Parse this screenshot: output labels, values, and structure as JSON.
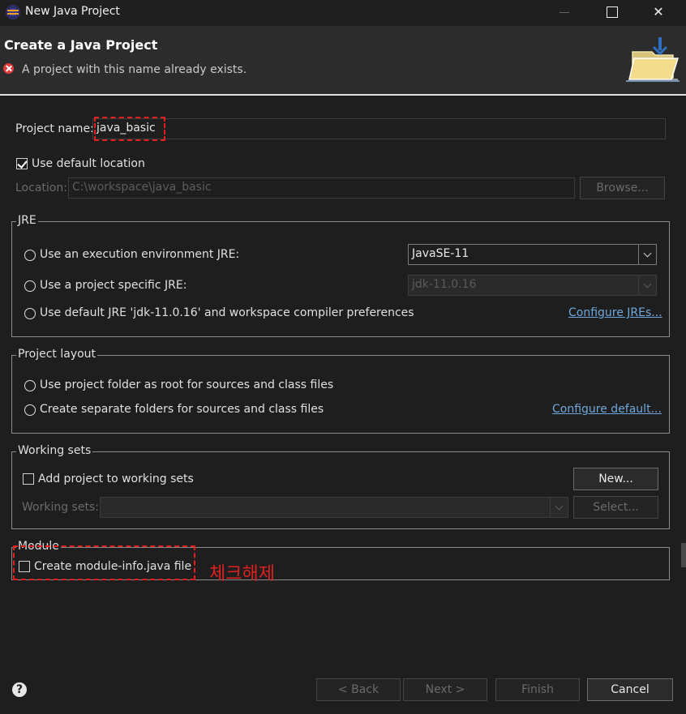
{
  "window": {
    "title": "New Java Project"
  },
  "header": {
    "title": "Create a Java Project",
    "message": "A project with this name already exists."
  },
  "project_name": {
    "label": "Project name:",
    "value": "java_basic"
  },
  "location": {
    "use_default_label": "Use default location",
    "use_default_checked": true,
    "label": "Location:",
    "value": "C:\\workspace\\java_basic",
    "browse_label": "Browse..."
  },
  "jre": {
    "title": "JRE",
    "option_env_label": "Use an execution environment JRE:",
    "env_value": "JavaSE-11",
    "option_specific_label": "Use a project specific JRE:",
    "specific_value": "jdk-11.0.16",
    "option_default_label": "Use default JRE 'jdk-11.0.16' and workspace compiler preferences",
    "configure_link": "Configure JREs..."
  },
  "layout": {
    "title": "Project layout",
    "option_root_label": "Use project folder as root for sources and class files",
    "option_separate_label": "Create separate folders for sources and class files",
    "configure_link": "Configure default..."
  },
  "working_sets": {
    "title": "Working sets",
    "add_label": "Add project to working sets",
    "add_checked": false,
    "new_label": "New...",
    "sets_label": "Working sets:",
    "sets_value": "",
    "select_label": "Select..."
  },
  "module": {
    "title": "Module",
    "create_label": "Create module-info.java file",
    "create_checked": false
  },
  "annotation": {
    "text": "체크해제",
    "color": "#e02020"
  },
  "footer": {
    "help_glyph": "?",
    "back_label": "< Back",
    "next_label": "Next >",
    "finish_label": "Finish",
    "cancel_label": "Cancel"
  }
}
